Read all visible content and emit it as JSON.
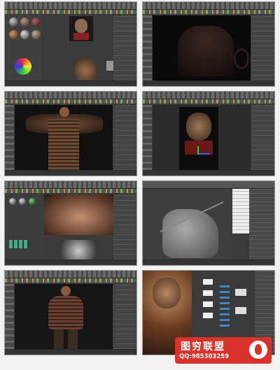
{
  "screens": [
    {
      "id": "material-editor",
      "content": "monkey-king-head-lookdev"
    },
    {
      "id": "armor-model",
      "content": "shoulder-armor-dark"
    },
    {
      "id": "body-armor-front",
      "content": "armor-body-textured"
    },
    {
      "id": "head-render-viewport",
      "content": "monkey-king-head-render"
    },
    {
      "id": "face-closeup-hair",
      "content": "face-fur-grooming"
    },
    {
      "id": "sculpt-statue",
      "content": "grey-statue-with-staff"
    },
    {
      "id": "full-character",
      "content": "full-body-armor-character"
    },
    {
      "id": "node-editor-render",
      "content": "final-render-node-graph"
    }
  ],
  "branding": {
    "title": "图穷联盟",
    "qq": "QQ:985303259",
    "logo_icon": "fire-icon",
    "color": "#d9322b"
  }
}
